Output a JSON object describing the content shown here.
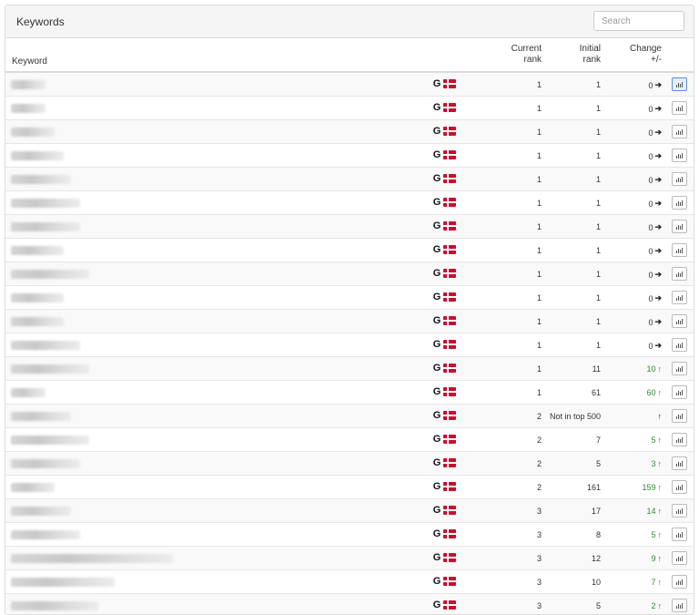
{
  "panel": {
    "title": "Keywords",
    "search_placeholder": "Search"
  },
  "columns": {
    "keyword": "Keyword",
    "current_rank_1": "Current",
    "current_rank_2": "rank",
    "initial_rank_1": "Initial",
    "initial_rank_2": "rank",
    "change_1": "Change",
    "change_2": "+/-"
  },
  "icons": {
    "search_engine": "google-g-icon",
    "country": "denmark-flag-icon",
    "chart": "bar-chart-icon",
    "arrow_right": "arrow-right-icon",
    "arrow_up": "arrow-up-icon"
  },
  "colors": {
    "positive": "#2e8b2e",
    "flag_red": "#c8102e",
    "header_bg": "#f5f5f5"
  },
  "engine_label": "G",
  "rows": [
    {
      "current": "1",
      "initial": "1",
      "change": "0",
      "trend": "neutral"
    },
    {
      "current": "1",
      "initial": "1",
      "change": "0",
      "trend": "neutral"
    },
    {
      "current": "1",
      "initial": "1",
      "change": "0",
      "trend": "neutral"
    },
    {
      "current": "1",
      "initial": "1",
      "change": "0",
      "trend": "neutral"
    },
    {
      "current": "1",
      "initial": "1",
      "change": "0",
      "trend": "neutral"
    },
    {
      "current": "1",
      "initial": "1",
      "change": "0",
      "trend": "neutral"
    },
    {
      "current": "1",
      "initial": "1",
      "change": "0",
      "trend": "neutral"
    },
    {
      "current": "1",
      "initial": "1",
      "change": "0",
      "trend": "neutral"
    },
    {
      "current": "1",
      "initial": "1",
      "change": "0",
      "trend": "neutral"
    },
    {
      "current": "1",
      "initial": "1",
      "change": "0",
      "trend": "neutral"
    },
    {
      "current": "1",
      "initial": "1",
      "change": "0",
      "trend": "neutral"
    },
    {
      "current": "1",
      "initial": "1",
      "change": "0",
      "trend": "neutral"
    },
    {
      "current": "1",
      "initial": "11",
      "change": "10",
      "trend": "up"
    },
    {
      "current": "1",
      "initial": "61",
      "change": "60",
      "trend": "up"
    },
    {
      "current": "2",
      "initial": "Not in top 500",
      "change": "",
      "trend": "new"
    },
    {
      "current": "2",
      "initial": "7",
      "change": "5",
      "trend": "up"
    },
    {
      "current": "2",
      "initial": "5",
      "change": "3",
      "trend": "up"
    },
    {
      "current": "2",
      "initial": "161",
      "change": "159",
      "trend": "up"
    },
    {
      "current": "3",
      "initial": "17",
      "change": "14",
      "trend": "up"
    },
    {
      "current": "3",
      "initial": "8",
      "change": "5",
      "trend": "up"
    },
    {
      "current": "3",
      "initial": "12",
      "change": "9",
      "trend": "up"
    },
    {
      "current": "3",
      "initial": "10",
      "change": "7",
      "trend": "up"
    },
    {
      "current": "3",
      "initial": "5",
      "change": "2",
      "trend": "up"
    }
  ]
}
